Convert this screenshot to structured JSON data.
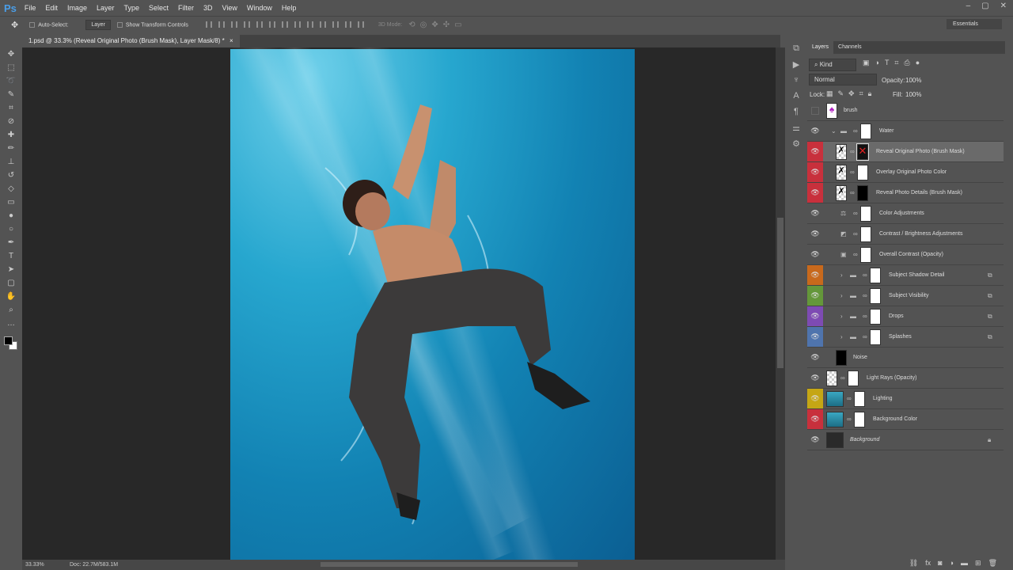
{
  "app": {
    "logo": "Ps"
  },
  "menu": [
    "File",
    "Edit",
    "Image",
    "Layer",
    "Type",
    "Select",
    "Filter",
    "3D",
    "View",
    "Window",
    "Help"
  ],
  "window_controls": [
    "–",
    "▢",
    "✕"
  ],
  "options": {
    "auto_select": "Auto-Select:",
    "target": "Layer",
    "show_transform": "Show Transform Controls",
    "mode_3d": "3D Mode:"
  },
  "workspace": "Essentials",
  "document_tab": {
    "title": "1.psd @ 33.3% (Reveal Original Photo (Brush Mask), Layer Mask/8) *",
    "close": "×"
  },
  "status": {
    "zoom": "33.33%",
    "doc": "Doc: 22.7M/583.1M"
  },
  "layers_panel": {
    "tabs": [
      "Layers",
      "Channels"
    ],
    "filter": "Kind",
    "blend_mode": "Normal",
    "opacity_label": "Opacity:",
    "opacity": "100%",
    "lock_label": "Lock:",
    "fill_label": "Fill:",
    "fill": "100%",
    "layers": [
      {
        "name": "brush",
        "color": "",
        "visible": false,
        "thumb": "brush",
        "indent": 0,
        "mask": false
      },
      {
        "name": "Water",
        "color": "",
        "visible": true,
        "thumb": "group-open",
        "indent": 0,
        "mask": true
      },
      {
        "name": "Reveal Original Photo (Brush Mask)",
        "color": "#c8303c",
        "visible": true,
        "thumb": "smart",
        "indent": 1,
        "mask": "x",
        "selected": true
      },
      {
        "name": "Overlay Original Photo Color",
        "color": "#c8303c",
        "visible": true,
        "thumb": "smart",
        "indent": 1,
        "mask": "white"
      },
      {
        "name": "Reveal Photo Details (Brush Mask)",
        "color": "#c8303c",
        "visible": true,
        "thumb": "smart",
        "indent": 1,
        "mask": "black"
      },
      {
        "name": "Color Adjustments",
        "color": "",
        "visible": true,
        "thumb": "balance",
        "indent": 1,
        "mask": "white"
      },
      {
        "name": "Contrast / Brightness Adjustments",
        "color": "",
        "visible": true,
        "thumb": "curves",
        "indent": 1,
        "mask": "white"
      },
      {
        "name": "Overall Contrast (Opacity)",
        "color": "",
        "visible": true,
        "thumb": "gradient",
        "indent": 1,
        "mask": "white"
      },
      {
        "name": "Subject Shadow Detail",
        "color": "#c8691c",
        "visible": true,
        "thumb": "group",
        "indent": 1,
        "mask": "white",
        "clip": true
      },
      {
        "name": "Subject Visibility",
        "color": "#64973a",
        "visible": true,
        "thumb": "group",
        "indent": 1,
        "mask": "white",
        "clip": true
      },
      {
        "name": "Drops",
        "color": "#7e4bb3",
        "visible": true,
        "thumb": "group",
        "indent": 1,
        "mask": "white",
        "clip": true
      },
      {
        "name": "Splashes",
        "color": "#4f74ad",
        "visible": true,
        "thumb": "group",
        "indent": 1,
        "mask": "white",
        "clip": true
      },
      {
        "name": "Noise",
        "color": "",
        "visible": true,
        "thumb": "black",
        "indent": 1,
        "mask": false
      },
      {
        "name": "Light Rays (Opacity)",
        "color": "",
        "visible": true,
        "thumb": "checker",
        "indent": 0,
        "mask": "white"
      },
      {
        "name": "Lighting",
        "color": "#c5a615",
        "visible": true,
        "thumb": "teal",
        "indent": 0,
        "mask": "white"
      },
      {
        "name": "Background Color",
        "color": "#c8303c",
        "visible": true,
        "thumb": "teal",
        "indent": 0,
        "mask": "white"
      },
      {
        "name": "Background",
        "color": "",
        "visible": true,
        "thumb": "photo",
        "indent": 0,
        "mask": false,
        "locked": true
      }
    ]
  }
}
